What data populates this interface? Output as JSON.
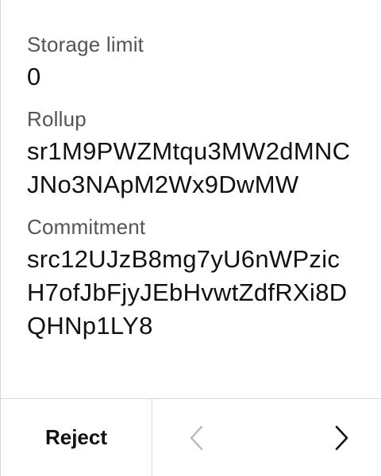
{
  "fields": {
    "storage_limit": {
      "label": "Storage limit",
      "value": "0"
    },
    "rollup": {
      "label": "Rollup",
      "value": "sr1M9PWZMtqu3MW2dMNCJNo3NApM2Wx9DwMW"
    },
    "commitment": {
      "label": "Commitment",
      "value": "src12UJzB8mg7yU6nWPzicH7ofJbFjyJEbHvwtZdfRXi8DQHNp1LY8"
    }
  },
  "footer": {
    "reject_label": "Reject",
    "prev_icon": "chevron-left-icon",
    "next_icon": "chevron-right-icon"
  },
  "colors": {
    "text": "#111111",
    "label": "#555555",
    "divider": "#d9d9d9",
    "disabled_icon": "#bbbbbb"
  }
}
